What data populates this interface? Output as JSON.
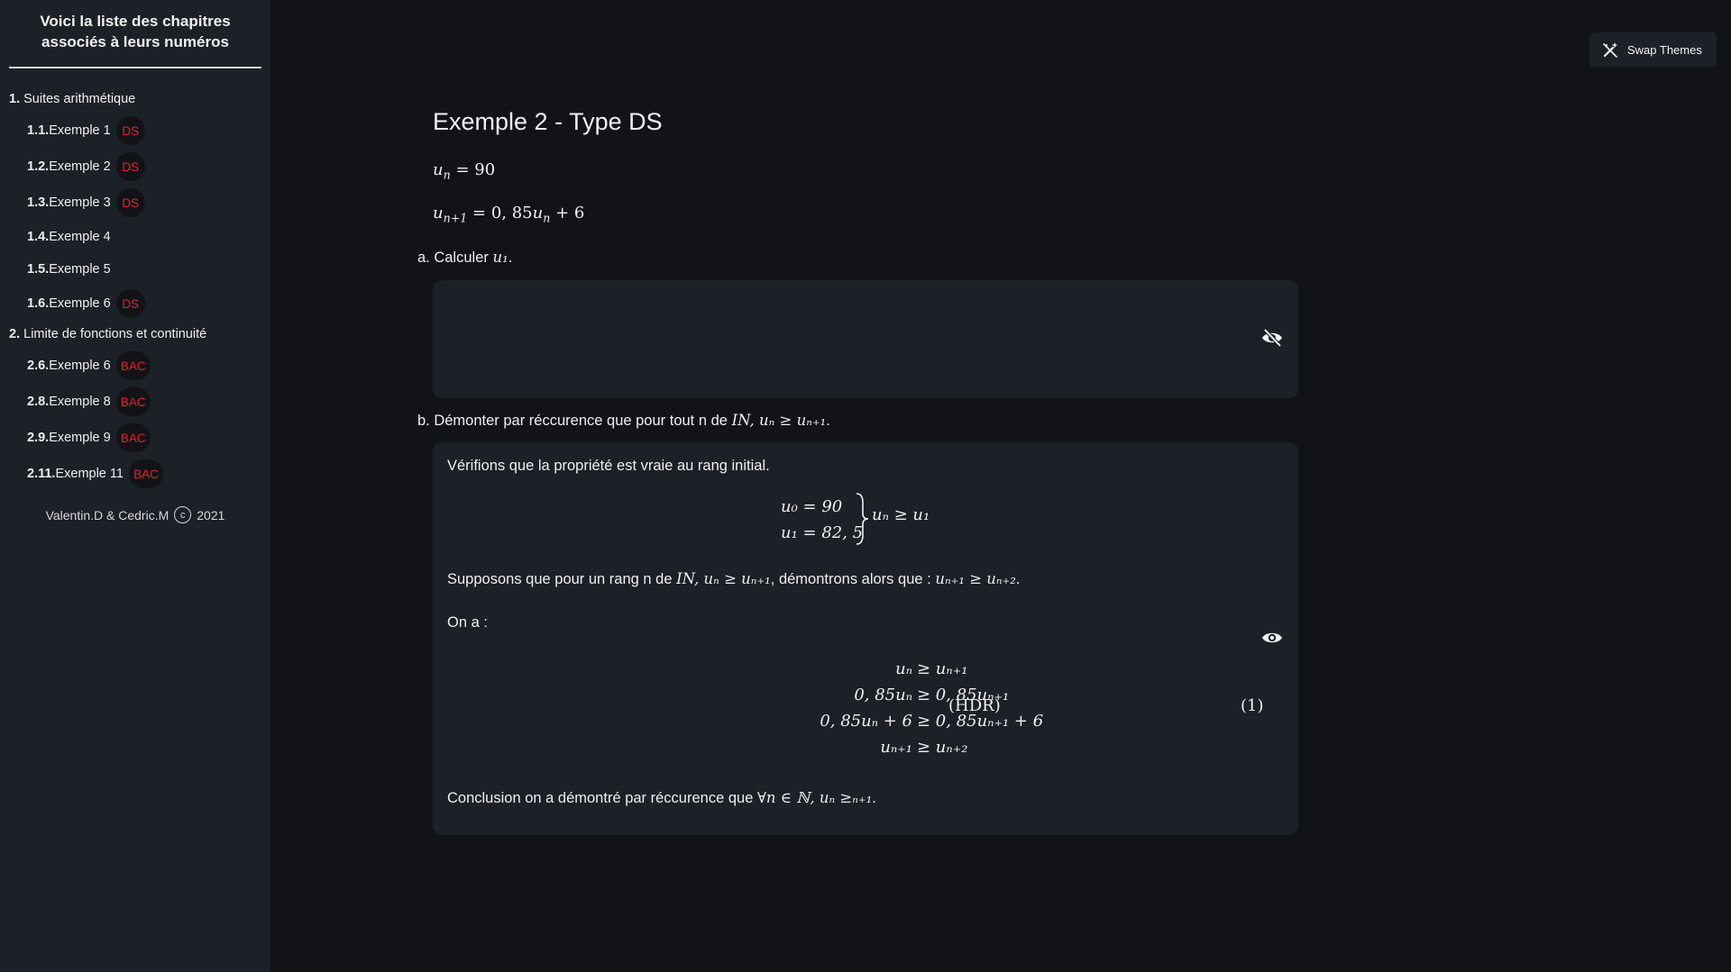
{
  "sidebar": {
    "title": "Voici la liste des chapitres associés à leurs numéros",
    "chapters": [
      {
        "num": "1.",
        "label": "Suites arithmétique",
        "items": [
          {
            "num": "1.1.",
            "label": "Exemple 1",
            "badge": "DS"
          },
          {
            "num": "1.2.",
            "label": "Exemple 2",
            "badge": "DS"
          },
          {
            "num": "1.3.",
            "label": "Exemple 3",
            "badge": "DS"
          },
          {
            "num": "1.4.",
            "label": "Exemple 4",
            "badge": ""
          },
          {
            "num": "1.5.",
            "label": "Exemple 5",
            "badge": ""
          },
          {
            "num": "1.6.",
            "label": "Exemple 6",
            "badge": "DS"
          }
        ]
      },
      {
        "num": "2.",
        "label": "Limite de fonctions et continuité",
        "items": [
          {
            "num": "2.6.",
            "label": "Exemple 6",
            "badge": "BAC"
          },
          {
            "num": "2.8.",
            "label": "Exemple 8",
            "badge": "BAC"
          },
          {
            "num": "2.9.",
            "label": "Exemple 9",
            "badge": "BAC"
          },
          {
            "num": "2.11.",
            "label": "Exemple 11",
            "badge": "BAC"
          }
        ]
      }
    ],
    "footer": {
      "authors": "Valentin.D & Cedric.M",
      "copyright_symbol": "c",
      "year": "2021"
    }
  },
  "header": {
    "swap_themes_label": "Swap Themes",
    "swap_icon": "magic-wand-icon"
  },
  "main": {
    "title": "Exemple 2 - Type DS",
    "given": [
      "u_n = 90",
      "u_{n+1} = 0,85u_n + 6"
    ],
    "question_a": "a. Calculer",
    "question_a_math": "u₁",
    "question_b": "b. Démonter par réccurence que pour tout n de",
    "question_b_math": "IN, uₙ ≥ uₙ₊₁",
    "answer_a_hidden_icon": "eye-slash-icon",
    "answer_b": {
      "intro": "Vérifions que la propriété est vraie au rang initial.",
      "system": [
        "u₀ = 90",
        "u₁ = 82, 5",
        "uₙ ≥ u₁"
      ],
      "hypothesis": "Supposons que pour un rang n de",
      "hypothesis_math": "IN, uₙ ≥ uₙ₊₁",
      "hypothesis_cont": ", démontrons alors que :",
      "hypothesis_goal": "uₙ₊₁ ≥ uₙ₊₂",
      "on_a": "On a :",
      "derivation": [
        {
          "lhs": "uₙ",
          "rhs": "≥ uₙ₊₁"
        },
        {
          "lhs": "0, 85uₙ",
          "rhs": "≥ 0, 85uₙ₊₁"
        },
        {
          "lhs": "0, 85uₙ + 6",
          "rhs": "≥ 0, 85uₙ₊₁ + 6"
        },
        {
          "lhs": "uₙ₊₁",
          "rhs": "≥ uₙ₊₂"
        }
      ],
      "tag": "(HDR)",
      "eq_number": "(1)",
      "conclusion": "Conclusion on a démontré par réccurence que",
      "conclusion_math": "∀n ∈ ℕ, uₙ ≥ₙ₊₁",
      "visible_icon": "eye-icon"
    }
  }
}
